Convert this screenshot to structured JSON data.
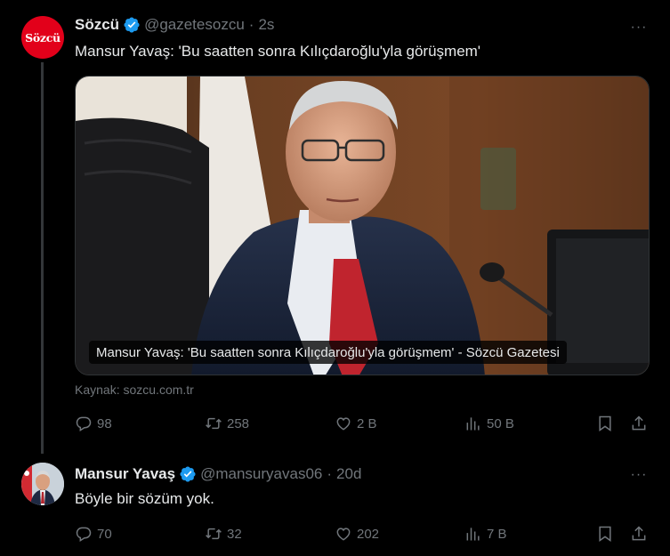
{
  "tweets": [
    {
      "display_name": "Sözcü",
      "handle": "@gazetesozcu",
      "separator": "·",
      "time": "2s",
      "avatar_text": "Sözcü",
      "avatar_color": "#e2001a",
      "text": "Mansur Yavaş: 'Bu saatten sonra Kılıçdaroğlu'yla görüşmem'",
      "card": {
        "caption": "Mansur Yavaş: 'Bu saatten sonra Kılıçdaroğlu'yla görüşmem' - Sözcü Gazetesi",
        "source": "Kaynak: sozcu.com.tr"
      },
      "actions": {
        "replies": "98",
        "retweets": "258",
        "likes": "2 B",
        "views": "50 B"
      },
      "more_label": "···"
    },
    {
      "display_name": "Mansur Yavaş",
      "handle": "@mansuryavas06",
      "separator": "·",
      "time": "20d",
      "text": "Böyle bir sözüm yok.",
      "actions": {
        "replies": "70",
        "retweets": "32",
        "likes": "202",
        "views": "7 B"
      },
      "more_label": "···"
    }
  ],
  "colors": {
    "verified": "#1d9bf0",
    "muted": "#71767b",
    "text": "#e7e9ea",
    "background": "#000000"
  },
  "icons": [
    "verified-badge-icon",
    "more-icon",
    "reply-icon",
    "retweet-icon",
    "like-icon",
    "views-icon",
    "bookmark-icon",
    "share-icon"
  ]
}
